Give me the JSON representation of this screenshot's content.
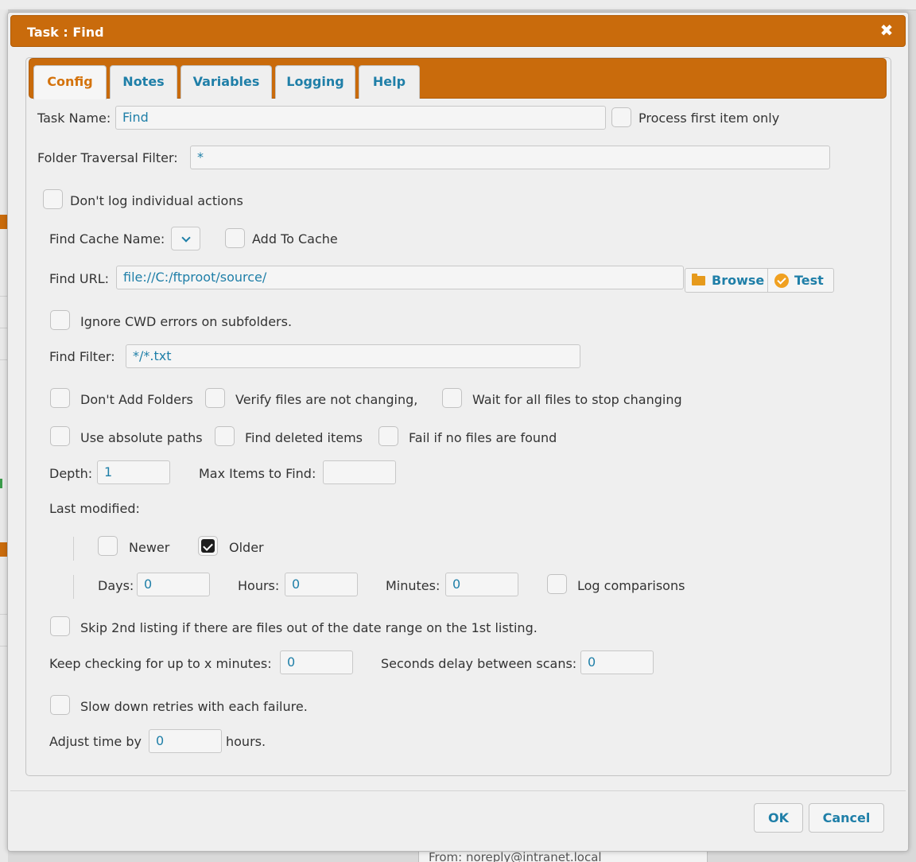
{
  "dialog": {
    "title": "Task : Find"
  },
  "tabs": [
    {
      "label": "Config",
      "active": true
    },
    {
      "label": "Notes"
    },
    {
      "label": "Variables"
    },
    {
      "label": "Logging"
    },
    {
      "label": "Help"
    }
  ],
  "config": {
    "task_name_label": "Task Name:",
    "task_name_value": "Find",
    "process_first_label": "Process first item only",
    "folder_filter_label": "Folder Traversal Filter:",
    "folder_filter_value": "*",
    "dont_log_label": "Don't log individual actions",
    "find_cache_label": "Find Cache Name:",
    "add_cache_label": "Add To Cache",
    "find_url_label": "Find URL:",
    "find_url_value": "file://C:/ftproot/source/",
    "browse_label": "Browse",
    "test_label": "Test",
    "ignore_cwd_label": "Ignore CWD errors on subfolders.",
    "find_filter_label": "Find Filter:",
    "find_filter_value": "*/*.txt",
    "dont_add_folders_label": "Don't Add Folders",
    "verify_files_label": "Verify files are not changing,",
    "wait_files_label": "Wait for all files to stop changing",
    "absolute_paths_label": "Use absolute paths",
    "find_deleted_label": "Find deleted items",
    "fail_no_files_label": "Fail if no files are found",
    "depth_label": "Depth:",
    "depth_value": "1",
    "max_items_label": "Max Items to Find:",
    "max_items_value": "",
    "last_modified_label": "Last modified:",
    "newer_label": "Newer",
    "older_label": "Older",
    "older_checked": true,
    "days_label": "Days:",
    "days_value": "0",
    "hours_label": "Hours:",
    "hours_value": "0",
    "minutes_label": "Minutes:",
    "minutes_value": "0",
    "log_comparisons_label": "Log comparisons",
    "skip_second_label": "Skip 2nd listing if there are files out of the date range on the 1st listing.",
    "keep_checking_label": "Keep checking for up to x minutes:",
    "keep_checking_value": "0",
    "seconds_delay_label": "Seconds delay between scans:",
    "seconds_delay_value": "0",
    "slow_down_label": "Slow down retries with each failure.",
    "adjust_time_label": "Adjust time by",
    "adjust_time_value": "0",
    "hours_suffix": "hours."
  },
  "footer": {
    "ok_label": "OK",
    "cancel_label": "Cancel"
  },
  "background": {
    "email_text": "From: noreply@intranet.local"
  }
}
